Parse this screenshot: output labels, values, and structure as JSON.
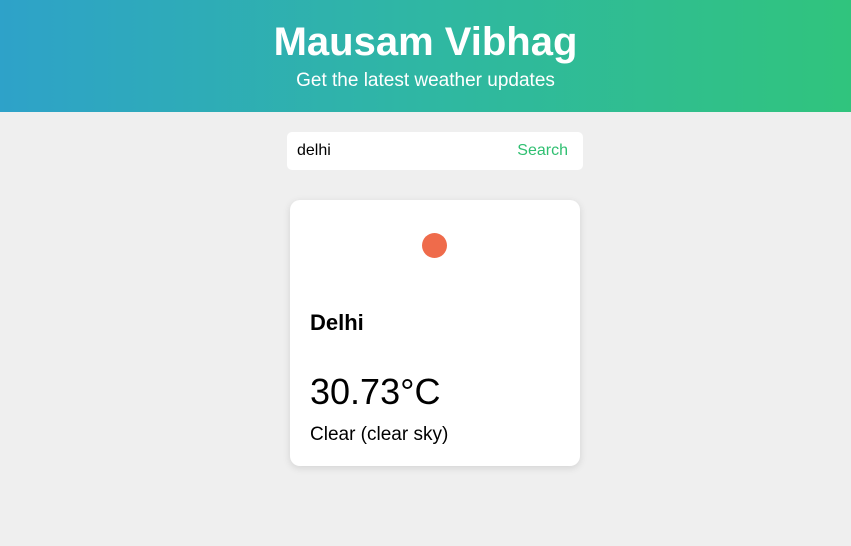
{
  "header": {
    "title": "Mausam Vibhag",
    "subtitle": "Get the latest weather updates"
  },
  "search": {
    "value": "delhi",
    "button_label": "Search"
  },
  "weather": {
    "icon": "sun-icon",
    "city": "Delhi",
    "temperature": "30.73°C",
    "condition": "Clear (clear sky)"
  },
  "colors": {
    "gradient_start": "#2ea2c9",
    "gradient_end": "#30c47d",
    "accent": "#2fbf71",
    "sun": "#ef6b4b",
    "background": "#efefef"
  }
}
